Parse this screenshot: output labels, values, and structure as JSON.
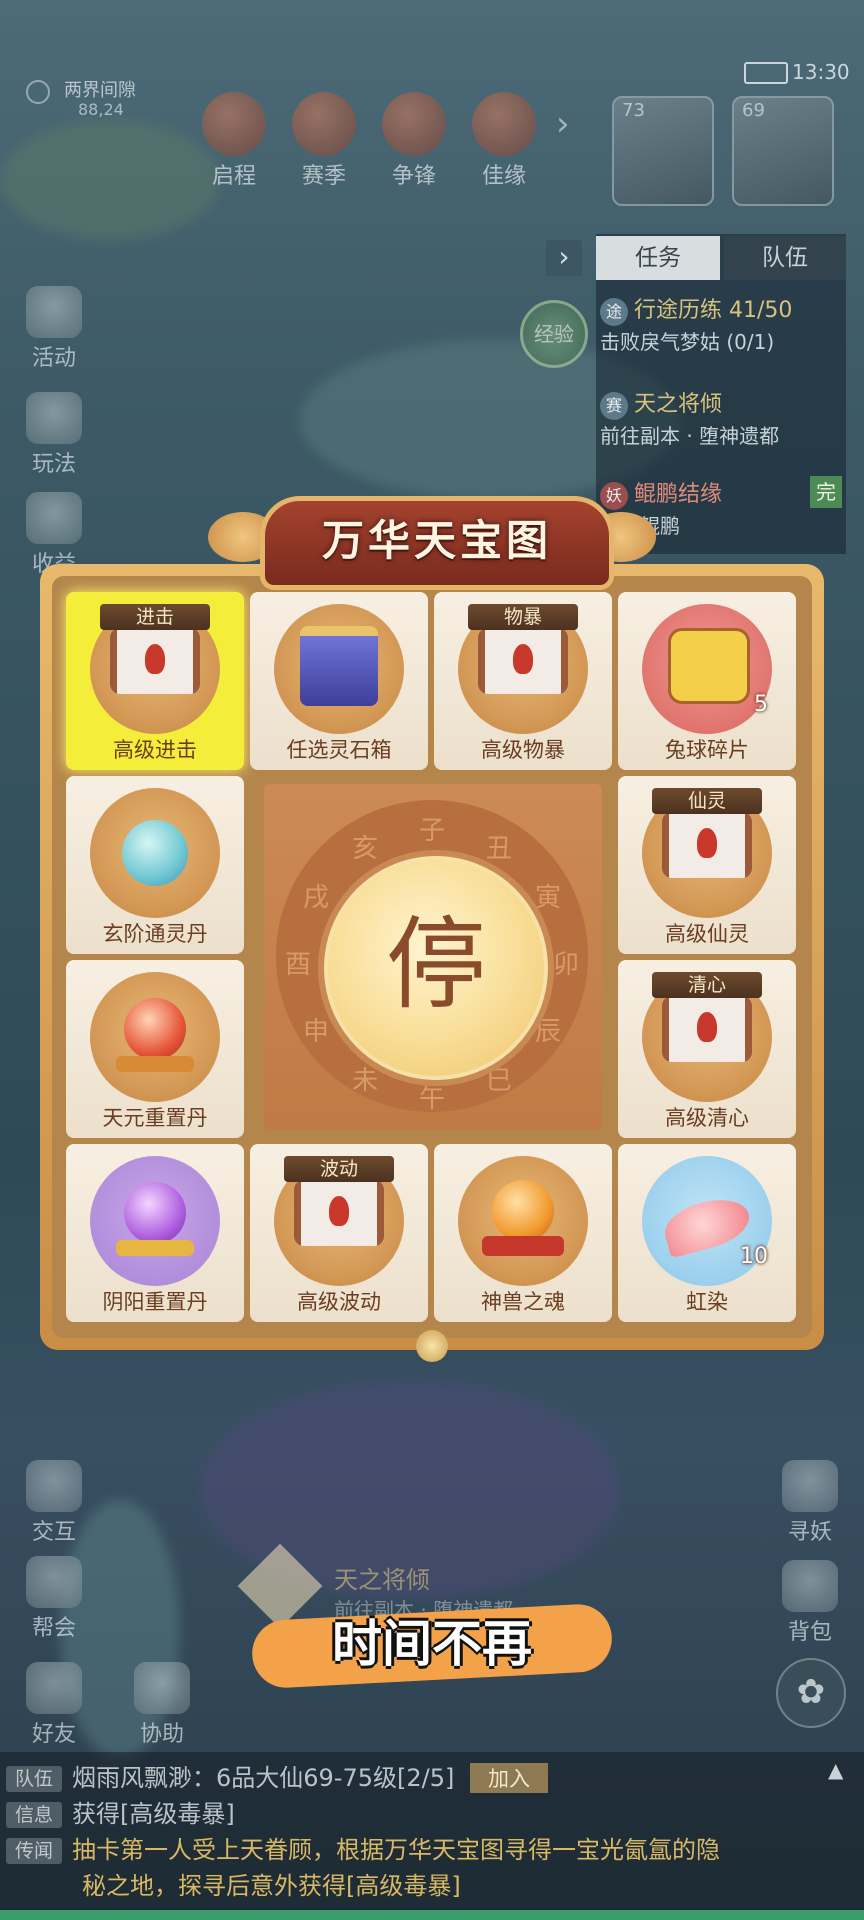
{
  "status_bar": {
    "time": "13:30"
  },
  "location": {
    "name": "两界间隙",
    "coords": "88,24"
  },
  "top_menu": [
    {
      "label": "启程"
    },
    {
      "label": "赛季"
    },
    {
      "label": "争锋"
    },
    {
      "label": "佳缘"
    }
  ],
  "portraits": [
    {
      "level": "73"
    },
    {
      "level": "69"
    }
  ],
  "left_menu": [
    {
      "label": "活动"
    },
    {
      "label": "玩法"
    },
    {
      "label": "收益"
    }
  ],
  "exp_badge": "经验",
  "quest_panel": {
    "tabs": [
      "任务",
      "队伍"
    ],
    "quests": [
      {
        "badge": "途",
        "title": "行途历练 41/50",
        "desc": "击败戾气梦姑 (0/1)"
      },
      {
        "badge": "赛",
        "title": "天之将倾",
        "desc": "前往副本 · 堕神遗都"
      },
      {
        "badge": "妖",
        "title": "鲲鹏结缘",
        "desc": "找寻鲲鹏",
        "status": "完"
      }
    ]
  },
  "board": {
    "title": "万华天宝图",
    "stop_label": "停",
    "ring_chars": [
      "子",
      "丑",
      "寅",
      "卯",
      "辰",
      "巳",
      "午",
      "未",
      "申",
      "酉",
      "戌",
      "亥"
    ],
    "cells": [
      {
        "name": "高级进击",
        "tag": "进击",
        "selected": true
      },
      {
        "name": "任选灵石箱"
      },
      {
        "name": "高级物暴",
        "tag": "物暴"
      },
      {
        "name": "兔球碎片",
        "count": "5"
      },
      {
        "name": "玄阶通灵丹"
      },
      {
        "name": "高级仙灵",
        "tag": "仙灵"
      },
      {
        "name": "天元重置丹"
      },
      {
        "name": "高级清心",
        "tag": "清心"
      },
      {
        "name": "阴阳重置丹"
      },
      {
        "name": "高级波动",
        "tag": "波动"
      },
      {
        "name": "神兽之魂"
      },
      {
        "name": "虹染",
        "count": "10"
      }
    ]
  },
  "bottom_left_menu": [
    {
      "label": "交互"
    },
    {
      "label": "帮会"
    },
    {
      "label": "好友"
    },
    {
      "label": "协助"
    }
  ],
  "bottom_right_menu": [
    {
      "label": "寻妖"
    },
    {
      "label": "背包"
    }
  ],
  "tracker": {
    "title": "天之将倾",
    "desc": "前往副本 · 堕神遗都"
  },
  "caption": "时间不再",
  "chat": [
    {
      "channel": "队伍",
      "text": "烟雨风飘渺：6品大仙69-75级[2/5]",
      "action": "加入"
    },
    {
      "channel": "信息",
      "text": "获得[高级毒暴]"
    },
    {
      "channel": "传闻",
      "text": "抽卡第一人受上天眷顾，根据万华天宝图寻得一宝光氤氲的隐",
      "text2": "秘之地，探寻后意外获得[高级毒暴]"
    }
  ]
}
